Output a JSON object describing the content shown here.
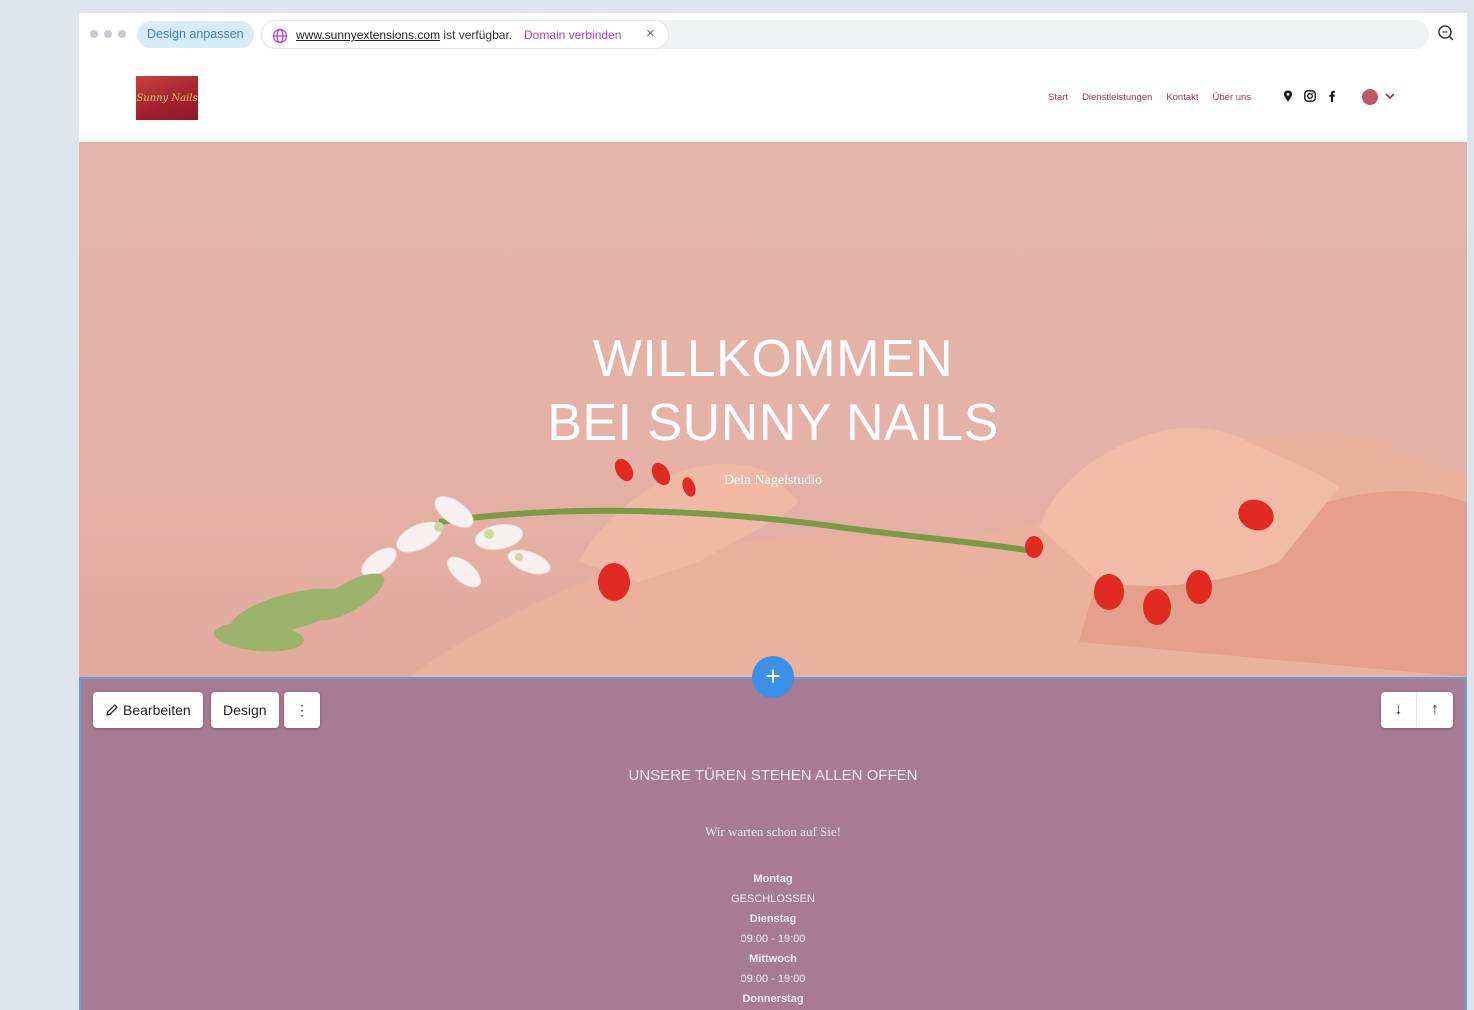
{
  "editor": {
    "design_label": "Design anpassen",
    "url_domain": "www.sunnyextensions.com",
    "url_suffix": " ist verfügbar.",
    "connect_label": "Domain verbinden",
    "close_symbol": "×"
  },
  "site": {
    "logo_text": "Sunny Nails",
    "nav": [
      "Start",
      "Dienstleistungen",
      "Kontakt",
      "Über uns"
    ]
  },
  "hero": {
    "title_line1": "WILLKOMMEN",
    "title_line2": "BEI SUNNY NAILS",
    "subtitle": "Dein Nagelstudio"
  },
  "toolbar": {
    "edit_label": "Bearbeiten",
    "design_label": "Design",
    "more_symbol": "⋮",
    "down_symbol": "↓",
    "up_symbol": "↑",
    "add_symbol": "+"
  },
  "hours": {
    "title": "UNSERE TÜREN STEHEN ALLEN OFFEN",
    "subtitle": "Wir warten schon auf Sie!",
    "entries": [
      {
        "day": "Montag",
        "time": "GESCHLOSSEN"
      },
      {
        "day": "Dienstag",
        "time": "09:00 - 19:00"
      },
      {
        "day": "Mittwoch",
        "time": "09:00 - 19:00"
      },
      {
        "day": "Donnerstag",
        "time": ""
      }
    ]
  },
  "colors": {
    "accent": "#3c91e6",
    "hero_bg": "#e2b4ab",
    "section_bg": "#a77b93",
    "nav_text": "#a0373f",
    "connect_link": "#b639c7"
  }
}
